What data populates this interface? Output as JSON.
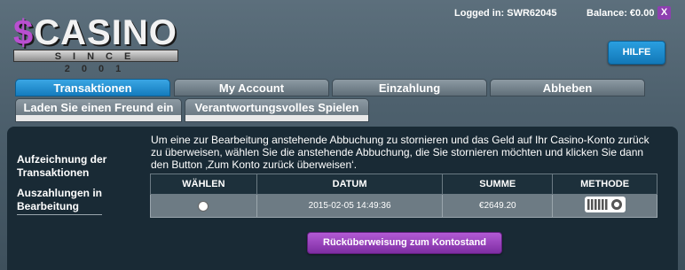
{
  "brand": {
    "logo_dollar": "$",
    "logo_text": "CASINO",
    "logo_since": "SINCE 2001"
  },
  "header": {
    "logged_in": "Logged in: SWR62045",
    "balance": "Balance: €0.00",
    "close_label": "X",
    "help_label": "HILFE"
  },
  "tabs_row1": [
    {
      "label": "Transaktionen",
      "active": true
    },
    {
      "label": "My Account",
      "active": false
    },
    {
      "label": "Einzahlung",
      "active": false
    },
    {
      "label": "Abheben",
      "active": false
    }
  ],
  "tabs_row2": [
    {
      "label": "Laden Sie einen Freund ein"
    },
    {
      "label": "Verantwortungsvolles Spielen"
    }
  ],
  "sidebar": {
    "items": [
      {
        "label": "Aufzeichnung der Transaktionen"
      },
      {
        "label": "Auszahlungen in Bearbeitung"
      }
    ]
  },
  "main": {
    "intro": "Um eine zur Bearbeitung anstehende Abbuchung zu stornieren und das Geld auf Ihr Casino-Konto zurück zu überweisen, wählen Sie die anstehende Abbuchung, die Sie stornieren möchten und klicken Sie dann den Button ‚Zum Konto zurück überweisen‘.",
    "table": {
      "headers": [
        "WÄHLEN",
        "DATUM",
        "SUMME",
        "METHODE"
      ],
      "rows": [
        {
          "date": "2015-02-05 14:49:36",
          "amount": "€2649.20",
          "method_icon": "payment-method-icon"
        }
      ]
    },
    "transfer_button": "Rücküberweisung zum Kontostand"
  }
}
